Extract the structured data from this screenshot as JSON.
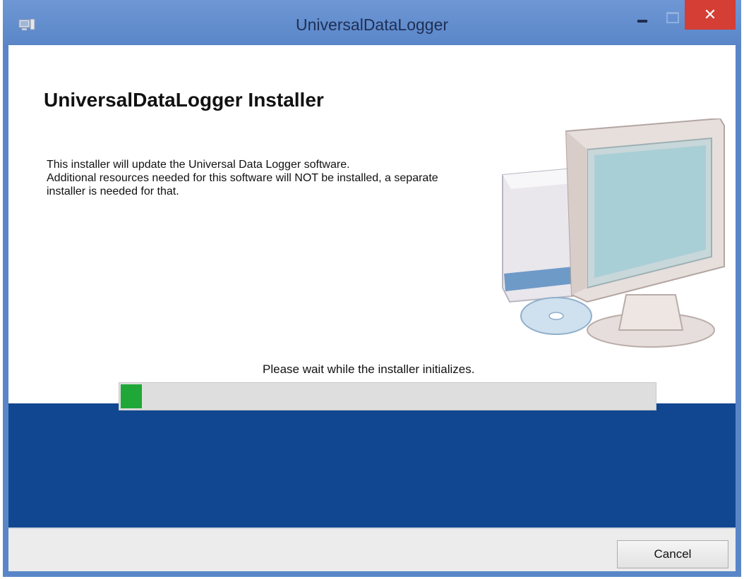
{
  "window": {
    "title": "UniversalDataLogger",
    "close_glyph": "✕"
  },
  "content": {
    "heading": "UniversalDataLogger Installer",
    "description_lines": [
      "This installer will update the Universal Data Logger software.",
      "Additional resources needed for this software will NOT be installed, a separate",
      "installer is needed for that."
    ],
    "illustration_icon": "computer-with-disc-icon"
  },
  "status": {
    "message": "Please wait while the installer initializes.",
    "progress_fraction": 0.04
  },
  "footer": {
    "cancel_label": "Cancel"
  },
  "colors": {
    "titlebar": "#5a86c8",
    "close_button": "#d43e34",
    "band": "#114790",
    "progress_fill": "#1fa838"
  }
}
